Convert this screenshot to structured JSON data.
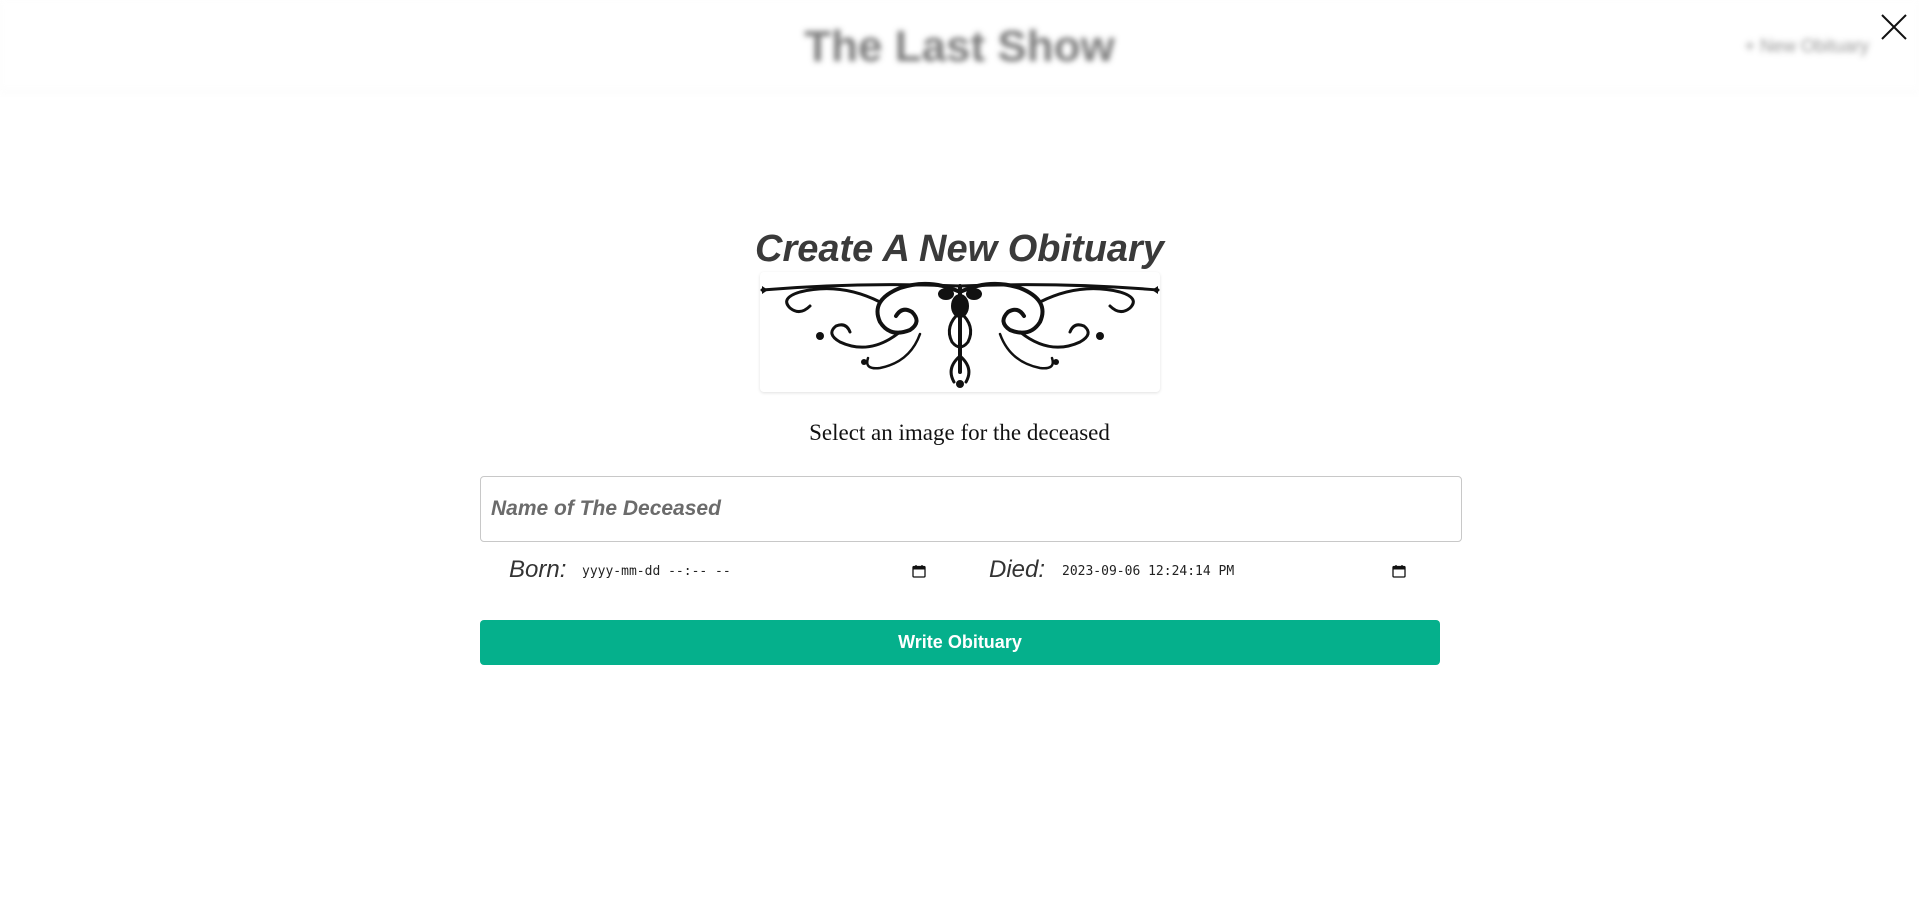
{
  "backdrop": {
    "app_title": "The Last Show",
    "new_obituary_link": "+ New Obituary"
  },
  "modal": {
    "close_icon": "close-icon",
    "title": "Create A New Obituary",
    "ornament_icon": "ornamental-flourish-image",
    "image_prompt": "Select an image for the deceased",
    "name_placeholder": "Name of The Deceased",
    "name_value": "",
    "born_label": "Born:",
    "born_value": "yyyy-mm-dd --:-- --",
    "died_label": "Died:",
    "died_value": "2023-09-06 12:24:14 PM",
    "calendar_icon": "calendar-icon",
    "submit_label": "Write Obituary"
  },
  "colors": {
    "accent": "#05b08c",
    "title_text": "#3a3a3a",
    "input_border": "#c8c8c8"
  }
}
